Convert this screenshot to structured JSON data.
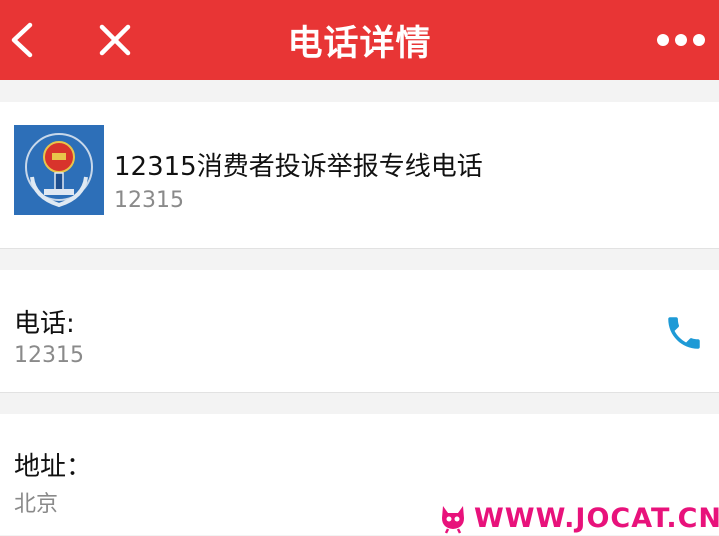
{
  "header": {
    "title": "电话详情"
  },
  "entry": {
    "name": "12315消费者投诉举报专线电话",
    "number": "12315"
  },
  "phone": {
    "label": "电话:",
    "value": "12315"
  },
  "address": {
    "label": "地址：",
    "value": "北京"
  },
  "watermark": {
    "text": "WWW.JOCAT.CN"
  },
  "colors": {
    "header_bg": "#e83535",
    "phone_icon": "#1e9ad6",
    "watermark": "#e8127b"
  }
}
